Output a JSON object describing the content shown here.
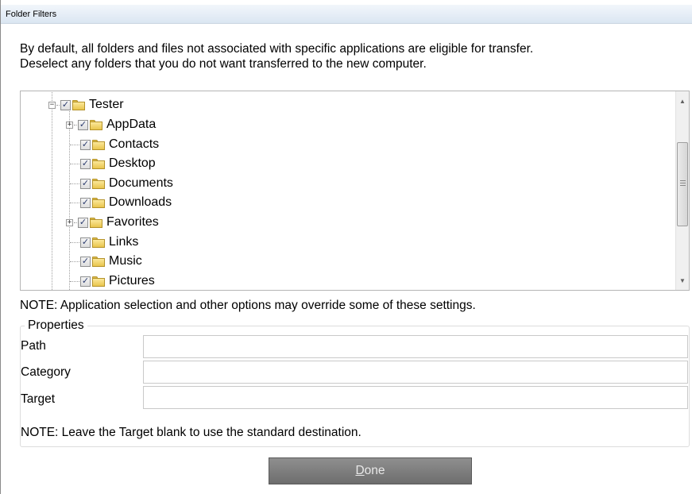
{
  "window": {
    "title": "Folder Filters"
  },
  "intro": {
    "line1": "By default, all folders and files not associated with specific applications are eligible for transfer.",
    "line2": "Deselect any folders that you do not want transferred to the new computer."
  },
  "tree": {
    "root": {
      "label": "Tester",
      "checked": true,
      "expanded": true
    },
    "children": [
      {
        "label": "AppData",
        "checked": true,
        "expandable": true
      },
      {
        "label": "Contacts",
        "checked": true,
        "expandable": false
      },
      {
        "label": "Desktop",
        "checked": true,
        "expandable": false
      },
      {
        "label": "Documents",
        "checked": true,
        "expandable": false
      },
      {
        "label": "Downloads",
        "checked": true,
        "expandable": false
      },
      {
        "label": "Favorites",
        "checked": true,
        "expandable": true
      },
      {
        "label": "Links",
        "checked": true,
        "expandable": false
      },
      {
        "label": "Music",
        "checked": true,
        "expandable": false
      },
      {
        "label": "Pictures",
        "checked": true,
        "expandable": false
      }
    ]
  },
  "note_override": "NOTE:  Application selection and other options may override some of these settings.",
  "properties": {
    "legend": "Properties",
    "path_label": "Path",
    "path_value": "",
    "category_label": "Category",
    "category_value": "",
    "target_label": "Target",
    "target_value": "",
    "note": "NOTE: Leave the Target blank to use the standard destination."
  },
  "done_button": {
    "accel": "D",
    "rest": "one"
  }
}
